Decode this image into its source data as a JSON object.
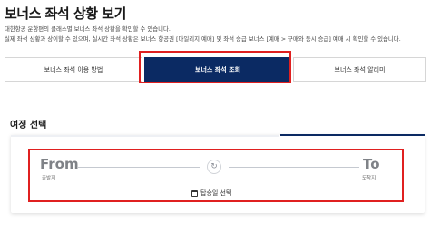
{
  "page": {
    "title": "보너스 좌석 상황 보기",
    "desc_line1": "대한항공 운항편의 클래스별 보너스 좌석 상황을 확인할 수 있습니다.",
    "desc_line2": "실제 좌석 상황과 상이할 수 있으며, 실시간 좌석 상황은 보너스 항공권 [마일리지 예매] 및 좌석 승급 보너스 [예매 > 구매와 동시 승급] 예매 시 확인할 수 있습니다."
  },
  "tabs": [
    {
      "label": "보너스 좌석 이용 방법",
      "active": false
    },
    {
      "label": "보너스 좌석 조회",
      "active": true
    },
    {
      "label": "보너스 좌석 알리미",
      "active": false
    }
  ],
  "itinerary": {
    "section_title": "여정 선택",
    "from_label": "From",
    "from_sub": "출발지",
    "to_label": "To",
    "to_sub": "도착지",
    "swap_icon": "swap-icon",
    "date_label": "탑승일 선택",
    "date_icon": "calendar-icon"
  },
  "colors": {
    "active_tab": "#0b2a63",
    "highlight": "#e02020",
    "placeholder_text": "#7f8287"
  }
}
